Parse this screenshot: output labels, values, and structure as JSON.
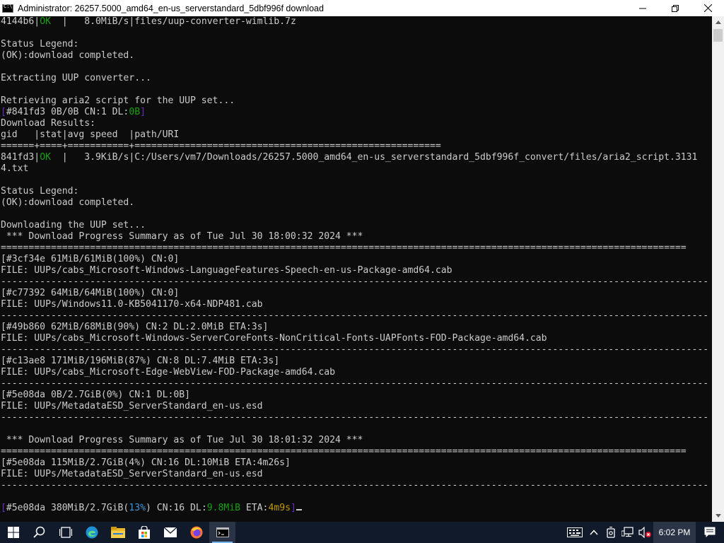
{
  "window": {
    "title": "Administrator:  26257.5000_amd64_en-us_serverstandard_5dbf996f download",
    "icon": "cmd-icon",
    "controls": [
      "minimize-icon",
      "maximize-icon",
      "close-icon"
    ]
  },
  "console": {
    "lines": [
      [
        {
          "t": "4144b6|"
        },
        {
          "t": "OK",
          "c": "g"
        },
        {
          "t": "  |   8.0MiB/s|files/uup-converter-wimlib.7z"
        }
      ],
      [
        {
          "t": ""
        }
      ],
      [
        {
          "t": "Status Legend:"
        }
      ],
      [
        {
          "t": "(OK):download completed."
        }
      ],
      [
        {
          "t": ""
        }
      ],
      [
        {
          "t": "Extracting UUP converter..."
        }
      ],
      [
        {
          "t": ""
        }
      ],
      [
        {
          "t": "Retrieving aria2 script for the UUP set..."
        }
      ],
      [
        {
          "t": "[",
          "c": "d"
        },
        {
          "t": "#841fd3 0B/0B CN:1 DL:"
        },
        {
          "t": "0B",
          "c": "g"
        },
        {
          "t": "]",
          "c": "d"
        }
      ],
      [
        {
          "t": "Download Results:"
        }
      ],
      [
        {
          "t": "gid   |stat|avg speed  |path/URI"
        }
      ],
      [
        {
          "t": "======+====+===========+======================================================="
        }
      ],
      [
        {
          "t": "841fd3|"
        },
        {
          "t": "OK",
          "c": "g"
        },
        {
          "t": "  |   3.9KiB/s|C:/Users/vm7/Downloads/26257.5000_amd64_en-us_serverstandard_5dbf996f_convert/files/aria2_script.3131"
        }
      ],
      [
        {
          "t": "4.txt"
        }
      ],
      [
        {
          "t": ""
        }
      ],
      [
        {
          "t": "Status Legend:"
        }
      ],
      [
        {
          "t": "(OK):download completed."
        }
      ],
      [
        {
          "t": ""
        }
      ],
      [
        {
          "t": "Downloading the UUP set..."
        }
      ],
      [
        {
          "t": " *** Download Progress Summary as of Tue Jul 30 18:00:32 2024 ***"
        }
      ],
      [
        {
          "t": "==========================================================================================================================="
        }
      ],
      [
        {
          "t": "[#3cf34e 61MiB/61MiB(100%) CN:0]"
        }
      ],
      [
        {
          "t": "FILE: UUPs/cabs_Microsoft-Windows-LanguageFeatures-Speech-en-us-Package-amd64.cab"
        }
      ],
      [
        {
          "t": "-------------------------------------------------------------------------------------------------------------------------------"
        }
      ],
      [
        {
          "t": "[#c77392 64MiB/64MiB(100%) CN:0]"
        }
      ],
      [
        {
          "t": "FILE: UUPs/Windows11.0-KB5041170-x64-NDP481.cab"
        }
      ],
      [
        {
          "t": "-------------------------------------------------------------------------------------------------------------------------------"
        }
      ],
      [
        {
          "t": "[#49b860 62MiB/68MiB(90%) CN:2 DL:2.0MiB ETA:3s]"
        }
      ],
      [
        {
          "t": "FILE: UUPs/cabs_Microsoft-Windows-ServerCoreFonts-NonCritical-Fonts-UAPFonts-FOD-Package-amd64.cab"
        }
      ],
      [
        {
          "t": "-------------------------------------------------------------------------------------------------------------------------------"
        }
      ],
      [
        {
          "t": "[#c13ae8 171MiB/196MiB(87%) CN:8 DL:7.4MiB ETA:3s]"
        }
      ],
      [
        {
          "t": "FILE: UUPs/cabs_Microsoft-Edge-WebView-FOD-Package-amd64.cab"
        }
      ],
      [
        {
          "t": "-------------------------------------------------------------------------------------------------------------------------------"
        }
      ],
      [
        {
          "t": "[#5e08da 0B/2.7GiB(0%) CN:1 DL:0B]"
        }
      ],
      [
        {
          "t": "FILE: UUPs/MetadataESD_ServerStandard_en-us.esd"
        }
      ],
      [
        {
          "t": "-------------------------------------------------------------------------------------------------------------------------------"
        }
      ],
      [
        {
          "t": ""
        }
      ],
      [
        {
          "t": " *** Download Progress Summary as of Tue Jul 30 18:01:32 2024 ***"
        }
      ],
      [
        {
          "t": "==========================================================================================================================="
        }
      ],
      [
        {
          "t": "[#5e08da 115MiB/2.7GiB(4%) CN:16 DL:10MiB ETA:4m26s]"
        }
      ],
      [
        {
          "t": "FILE: UUPs/MetadataESD_ServerStandard_en-us.esd"
        }
      ],
      [
        {
          "t": "-------------------------------------------------------------------------------------------------------------------------------"
        }
      ],
      [
        {
          "t": ""
        }
      ],
      [
        {
          "t": "[",
          "c": "d"
        },
        {
          "t": "#5e08da 380MiB/2.7GiB("
        },
        {
          "t": "13%",
          "c": "c"
        },
        {
          "t": ") CN:16 DL:"
        },
        {
          "t": "9.8MiB",
          "c": "g"
        },
        {
          "t": " ETA:"
        },
        {
          "t": "4m9s",
          "c": "y"
        },
        {
          "t": "]",
          "c": "d"
        }
      ]
    ]
  },
  "taskbar": {
    "apps": [
      "windows-start-icon",
      "search-icon",
      "task-view-icon",
      "edge-icon",
      "file-explorer-icon",
      "store-icon",
      "mail-icon",
      "firefox-icon",
      "cmd-taskbar-icon"
    ],
    "tray": [
      "input-indicator-icon",
      "chevron-up-icon",
      "device-icon",
      "network-icon",
      "volume-muted-icon"
    ],
    "clock": "6:02 PM",
    "notification_icon": "action-center-icon"
  },
  "colors": {
    "console_bg": "#0c0c0c",
    "console_text": "#cccccc",
    "green": "#13a10e",
    "cyan": "#3a96dd",
    "yellow": "#c19c00",
    "taskbar_bg": "#101a2b"
  }
}
